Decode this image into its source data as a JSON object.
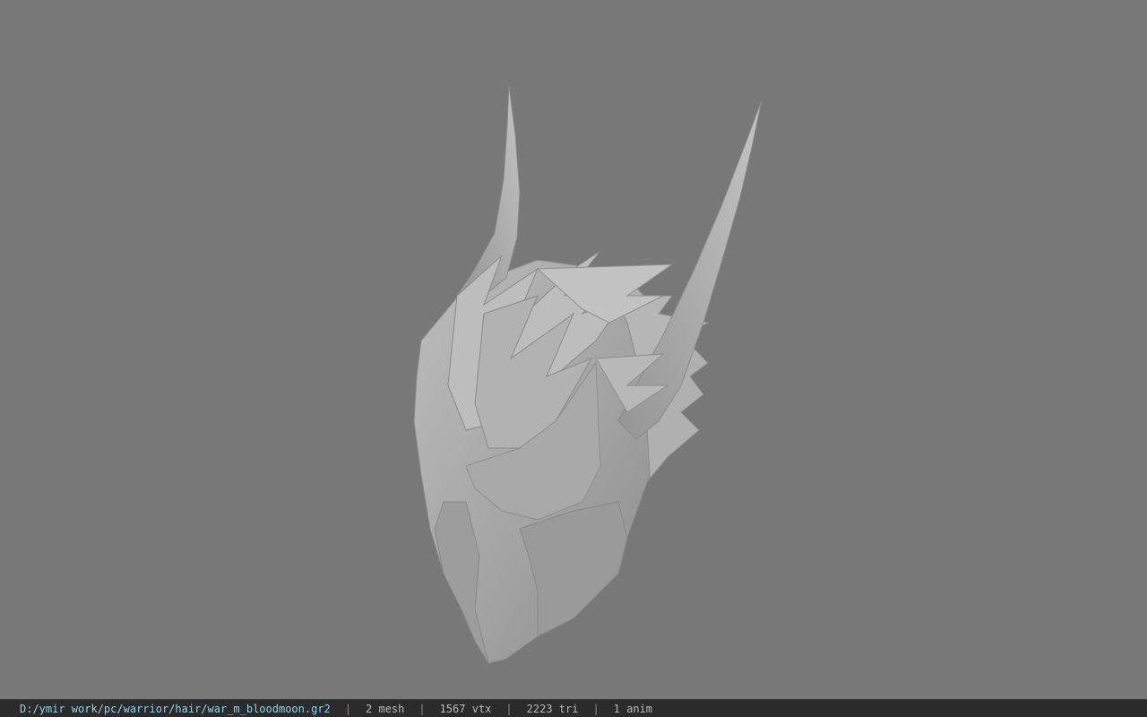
{
  "viewport": {
    "model_icon": "hair-mesh-model",
    "background_color": "#787878",
    "model_color": "#a3a3a3"
  },
  "status": {
    "file_path": "D:/ymir work/pc/warrior/hair/war_m_bloodmoon.gr2",
    "separator": "|",
    "mesh": "2 mesh",
    "vertices": "1567 vtx",
    "triangles": "2223 tri",
    "animations": "1 anim",
    "path_color": "#8fd3e6"
  }
}
